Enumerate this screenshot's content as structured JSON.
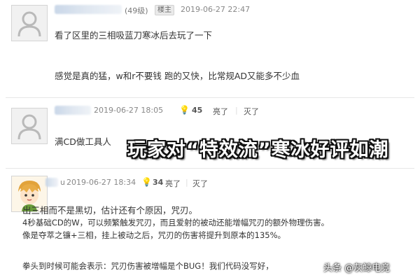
{
  "posts": [
    {
      "level": "(49级)",
      "floor_badge": "楼主",
      "timestamp": "2019-06-27 22:47",
      "lines": [
        "看了区里的三相吸蓝刀寒冰后去玩了一下",
        "感觉是真的猛，w和r不要钱 跑的又快，比常规AD又能多不少血"
      ]
    },
    {
      "timestamp": "2019-06-27 18:05",
      "like_count": "45",
      "like_label": "亮了",
      "dislike_label": "灭了",
      "lines": [
        "满CD做工具人"
      ]
    },
    {
      "username_fragment": "u",
      "timestamp": "2019-06-27 18:34",
      "like_count": "34",
      "like_label": "亮了",
      "dislike_label": "灭了",
      "lines": [
        "出三相而不是黑切，估计还有个原因，咒刃。",
        "4秒基础CD的W，可以频繁触发咒刃，而且爱射的被动还能增幅咒刃的额外物理伤害。",
        "像是夺萃之镰+三相，挂上被动之后，咒刃的伤害将提升到原本的135%。",
        "拳头到时候可能会表示：咒刃伤害被增幅是个BUG！我们代码没写好，"
      ]
    }
  ],
  "overlay": {
    "headline": "玩家对“特效流”寒冰好评如潮",
    "watermark": "头条 @灰鲸电竞"
  },
  "icons": {
    "avatar_default": "default-user-avatar-icon",
    "avatar_cartoon": "cartoon-character-avatar-icon",
    "like": "lightbulb-icon"
  },
  "colors": {
    "headline_fill": "#ffffff",
    "headline_outline": "#111111",
    "meta_text": "#888888",
    "like_icon": "#e0a11b"
  }
}
